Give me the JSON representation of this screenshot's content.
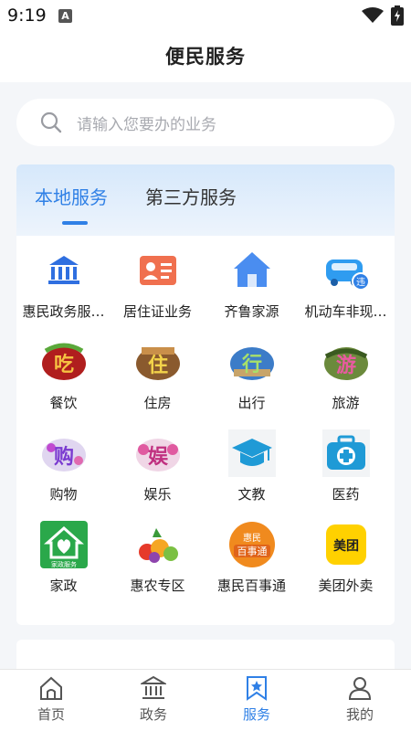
{
  "status": {
    "time": "9:19"
  },
  "header": {
    "title": "便民服务"
  },
  "search": {
    "placeholder": "请输入您要办的业务"
  },
  "tabs": [
    {
      "label": "本地服务",
      "active": true
    },
    {
      "label": "第三方服务",
      "active": false
    }
  ],
  "services": [
    {
      "label": "惠民政务服…",
      "icon": "government-icon"
    },
    {
      "label": "居住证业务",
      "icon": "id-card-icon"
    },
    {
      "label": "齐鲁家源",
      "icon": "home-icon"
    },
    {
      "label": "机动车非现…",
      "icon": "car-violation-icon"
    },
    {
      "label": "餐饮",
      "icon": "dining-icon",
      "glyph": "吃"
    },
    {
      "label": "住房",
      "icon": "housing-icon",
      "glyph": "住"
    },
    {
      "label": "出行",
      "icon": "travel-icon",
      "glyph": "行"
    },
    {
      "label": "旅游",
      "icon": "tourism-icon",
      "glyph": "游"
    },
    {
      "label": "购物",
      "icon": "shopping-icon",
      "glyph": "购"
    },
    {
      "label": "娱乐",
      "icon": "entertainment-icon",
      "glyph": "娱"
    },
    {
      "label": "文教",
      "icon": "graduation-cap-icon"
    },
    {
      "label": "医药",
      "icon": "medical-kit-icon"
    },
    {
      "label": "家政",
      "icon": "housekeeping-icon",
      "glyph": "家政服务"
    },
    {
      "label": "惠农专区",
      "icon": "farm-produce-icon"
    },
    {
      "label": "惠民百事通",
      "icon": "huimin-baishitong-icon",
      "glyph_top": "惠民",
      "glyph_bottom": "百事通"
    },
    {
      "label": "美团外卖",
      "icon": "meituan-icon",
      "glyph": "美团"
    }
  ],
  "tabbar": [
    {
      "label": "首页",
      "icon": "home-outline-icon",
      "active": false
    },
    {
      "label": "政务",
      "icon": "government-outline-icon",
      "active": false
    },
    {
      "label": "服务",
      "icon": "bookmark-star-icon",
      "active": true
    },
    {
      "label": "我的",
      "icon": "user-icon",
      "active": false
    }
  ],
  "colors": {
    "accent": "#2f80e6",
    "page_bg": "#f4f6f9"
  }
}
